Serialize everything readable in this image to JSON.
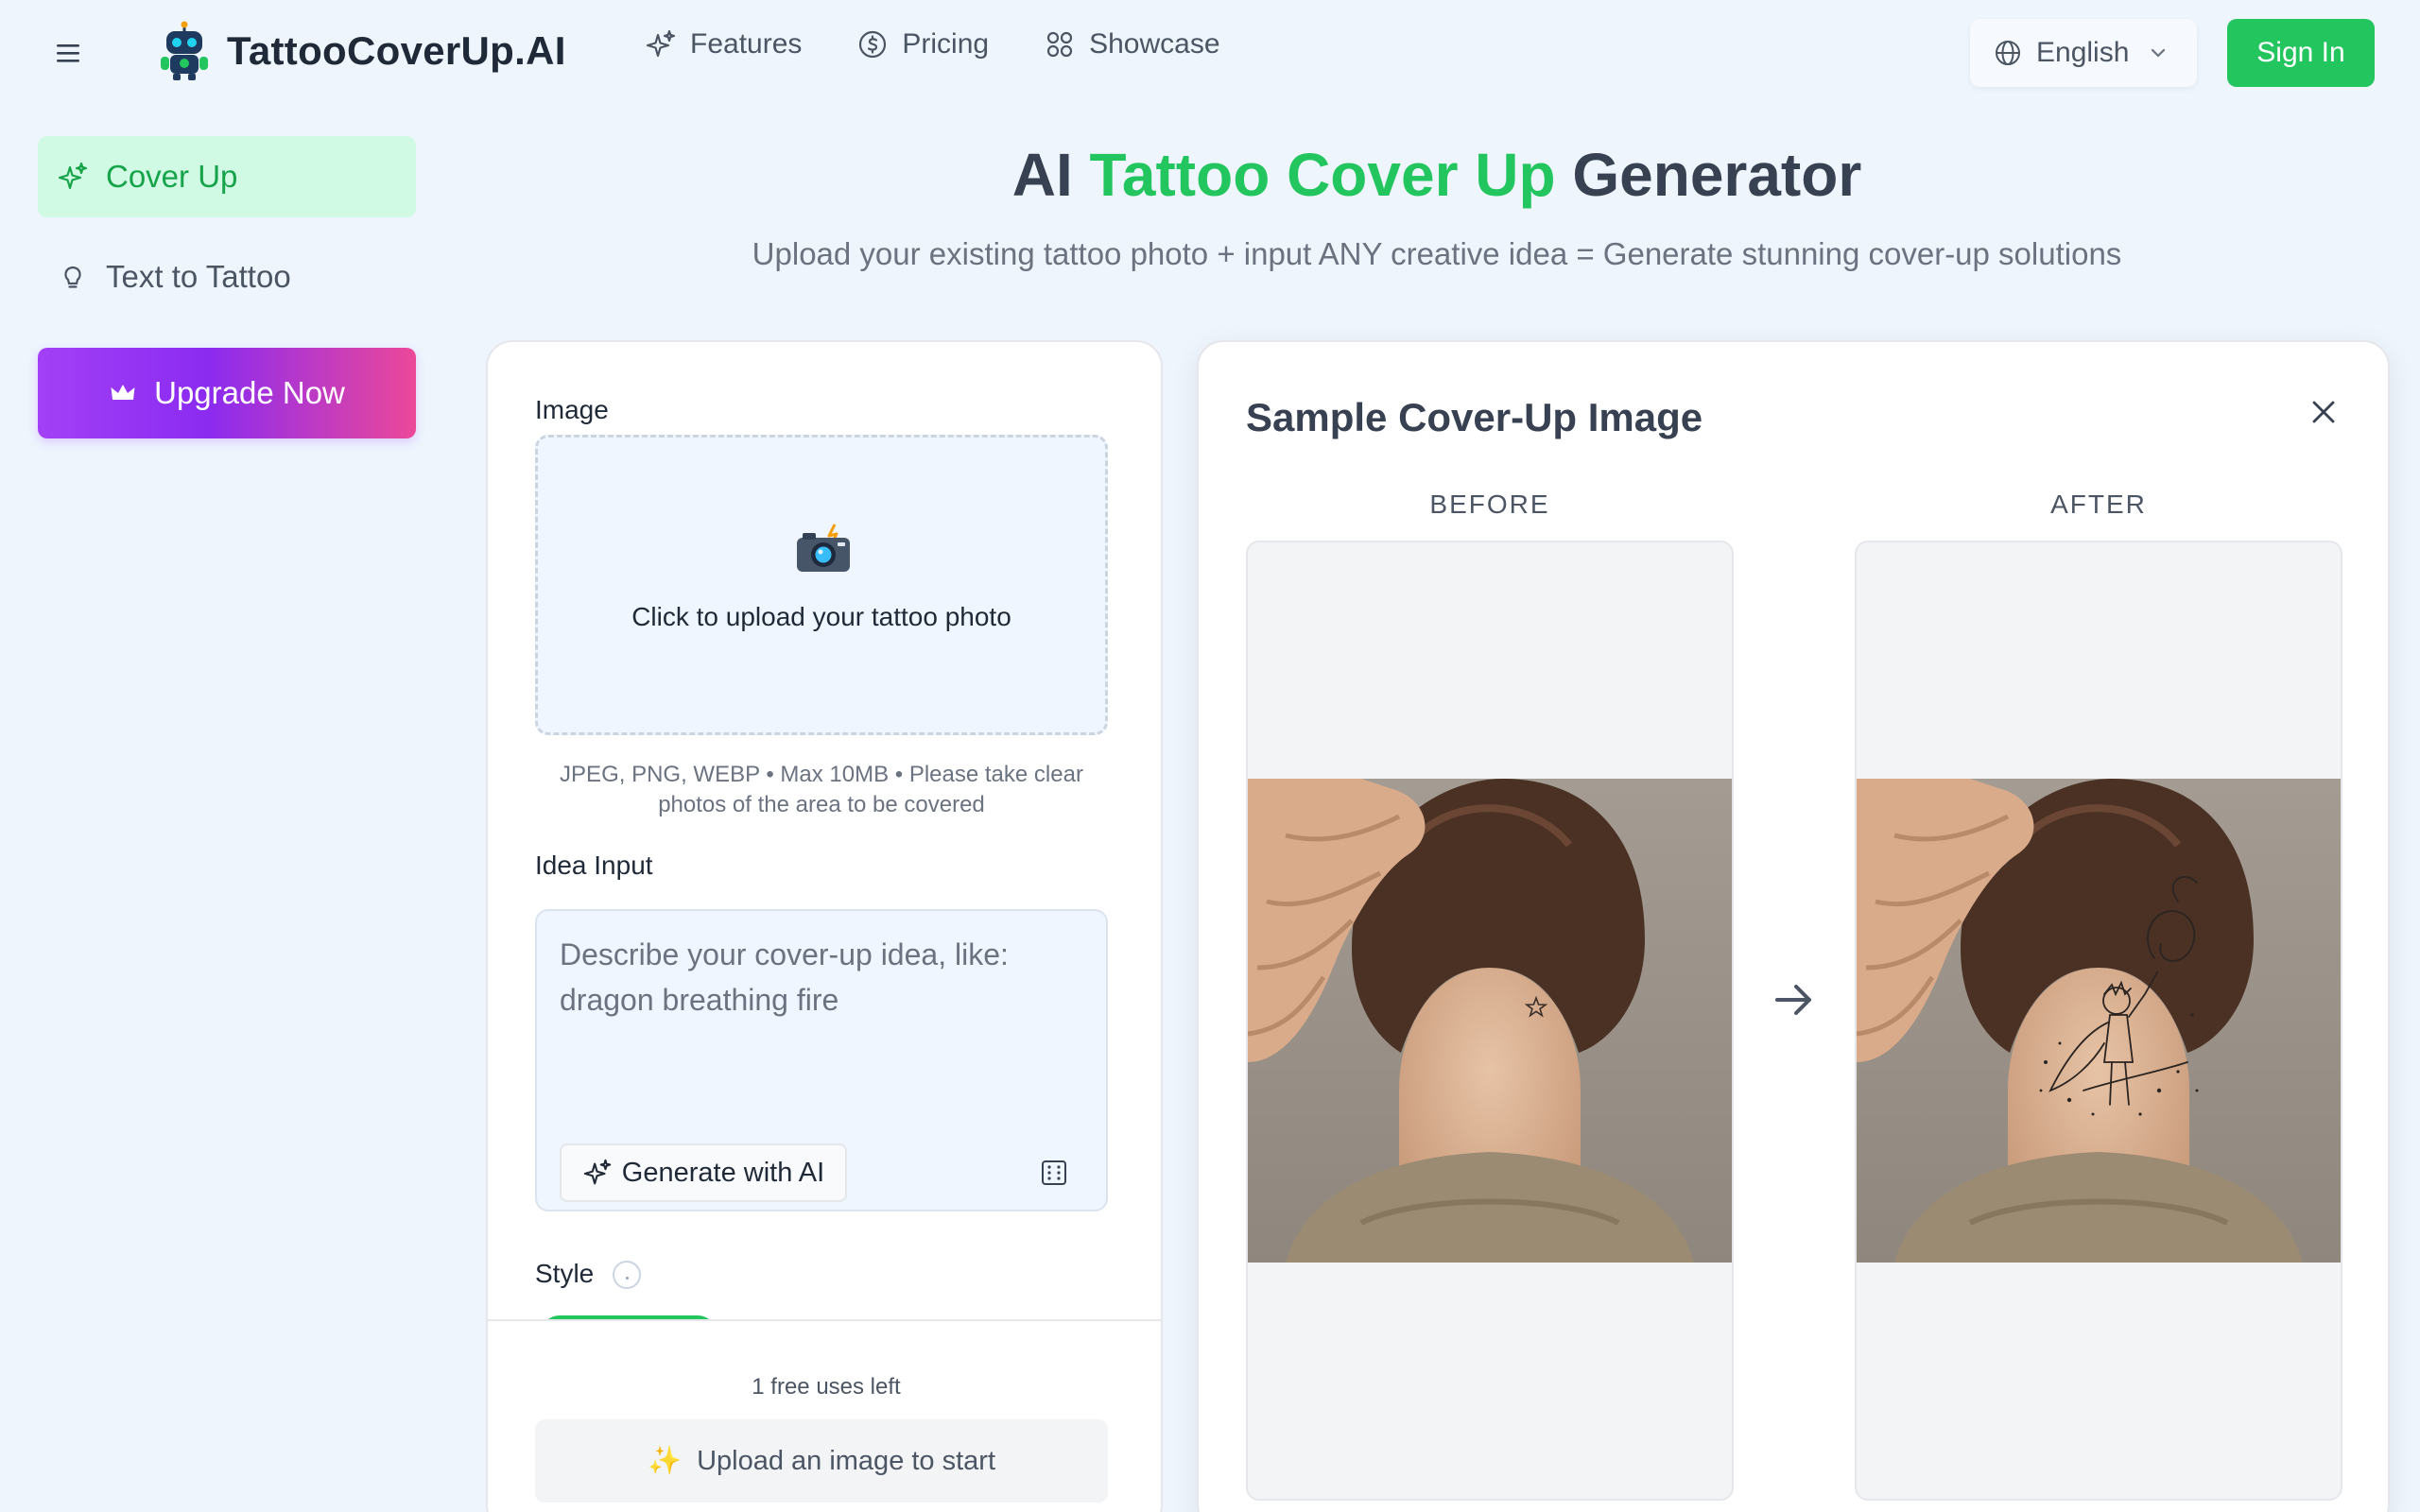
{
  "header": {
    "brand": "TattooCoverUp.AI",
    "nav": [
      {
        "label": "Features",
        "icon": "sparkles-icon"
      },
      {
        "label": "Pricing",
        "icon": "dollar-circle-icon"
      },
      {
        "label": "Showcase",
        "icon": "grid-icon"
      }
    ],
    "language": "English",
    "sign_in": "Sign In"
  },
  "sidebar": {
    "items": [
      {
        "label": "Cover Up",
        "icon": "sparkles-icon",
        "active": true
      },
      {
        "label": "Text to Tattoo",
        "icon": "lightbulb-icon",
        "active": false
      }
    ],
    "upgrade_label": "Upgrade Now"
  },
  "hero": {
    "title_pre": "AI ",
    "title_accent": "Tattoo Cover Up",
    "title_post": " Generator",
    "subtitle": "Upload your existing tattoo photo + input ANY creative idea = Generate stunning cover-up solutions"
  },
  "form": {
    "image_label": "Image",
    "upload_emoji": "📸",
    "upload_text": "Click to upload your tattoo photo",
    "upload_hint": "JPEG, PNG, WEBP • Max 10MB • Please take clear photos of the area to be covered",
    "idea_label": "Idea Input",
    "idea_placeholder": "Describe your cover-up idea, like: dragon breathing fire",
    "generate_ai": "Generate with AI",
    "style_label": "Style",
    "uses_left": "1 free uses left",
    "start_icon": "✨",
    "start_label": "Upload an image to start"
  },
  "sample": {
    "title": "Sample Cover-Up Image",
    "before_label": "BEFORE",
    "after_label": "AFTER"
  },
  "colors": {
    "accent": "#22c55e",
    "upgrade_gradient": [
      "#a240f7",
      "#ec4899"
    ],
    "background": "#eef5fd"
  }
}
